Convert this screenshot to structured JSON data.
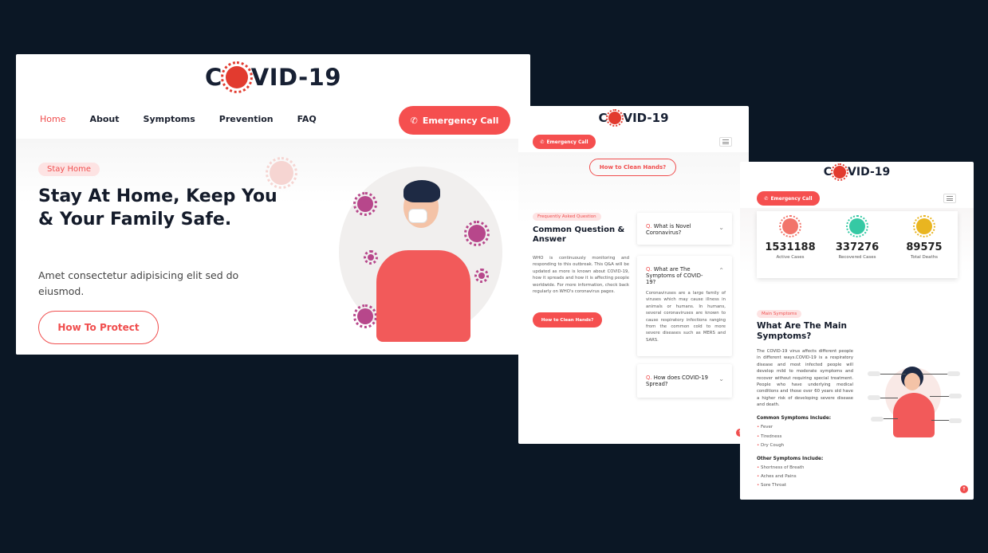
{
  "brand": {
    "pre": "C",
    "post": "VID-19"
  },
  "card1": {
    "nav": [
      "Home",
      "About",
      "Symptoms",
      "Prevention",
      "FAQ"
    ],
    "emergency_label": "Emergency Call",
    "tag": "Stay Home",
    "headline": "Stay At Home, Keep You & Your Family Safe.",
    "description": "Amet consectetur adipisicing elit sed do eiusmod.",
    "cta": "How To Protect"
  },
  "card2": {
    "emergency_label": "Emergency Call",
    "hands_outline": "How to Clean Hands?",
    "tag": "Frequently Asked Question",
    "heading": "Common Question & Answer",
    "paragraph": "WHO is continuously monitoring and responding to this outbreak. This Q&A will be updated as more is known about COVID-19, how it spreads and how it is affecting people worldwide. For more information, check back regularly on WHO's coronavirus pages.",
    "hands_button": "How to Clean Hands?",
    "faqs": [
      {
        "prefix": "Q.",
        "question": "What is Novel Coronavirus?",
        "answer": ""
      },
      {
        "prefix": "Q.",
        "question": "What are The Symptoms of COVID-19?",
        "answer": "Coronaviruses are a large family of viruses which may cause illness in animals or humans. In humans, several coronaviruses are known to cause respiratory infections ranging from the common cold to more severe diseases such as MERS and SARS."
      },
      {
        "prefix": "Q.",
        "question": "How does COVID-19 Spread?",
        "answer": ""
      }
    ]
  },
  "card3": {
    "emergency_label": "Emergency Call",
    "stats": [
      {
        "value": "1531188",
        "label": "Active Cases",
        "color": "#f2746a"
      },
      {
        "value": "337276",
        "label": "Recovered Cases",
        "color": "#35c9a4"
      },
      {
        "value": "89575",
        "label": "Total Deaths",
        "color": "#e9b520"
      }
    ],
    "tag": "Main Symptoms",
    "heading": "What Are The Main Symptoms?",
    "paragraph": "The COVID-19 virus affects different people in different ways.COVID-19 is a respiratory disease and most infected people will develop mild to moderate symptoms and recover without requiring special treatment. People who have underlying medical conditions and those over 60 years old have a higher risk of developing severe disease and death.",
    "common_heading": "Common Symptoms Include:",
    "common": [
      "Fever",
      "Tiredness",
      "Dry Cough"
    ],
    "other_heading": "Other Symptoms Include:",
    "other": [
      "Shortness of Breath",
      "Aches and Pains",
      "Sore Throat"
    ]
  },
  "colors": {
    "accent": "#f04e4e",
    "background": "#0b1725",
    "navy": "#172033"
  }
}
